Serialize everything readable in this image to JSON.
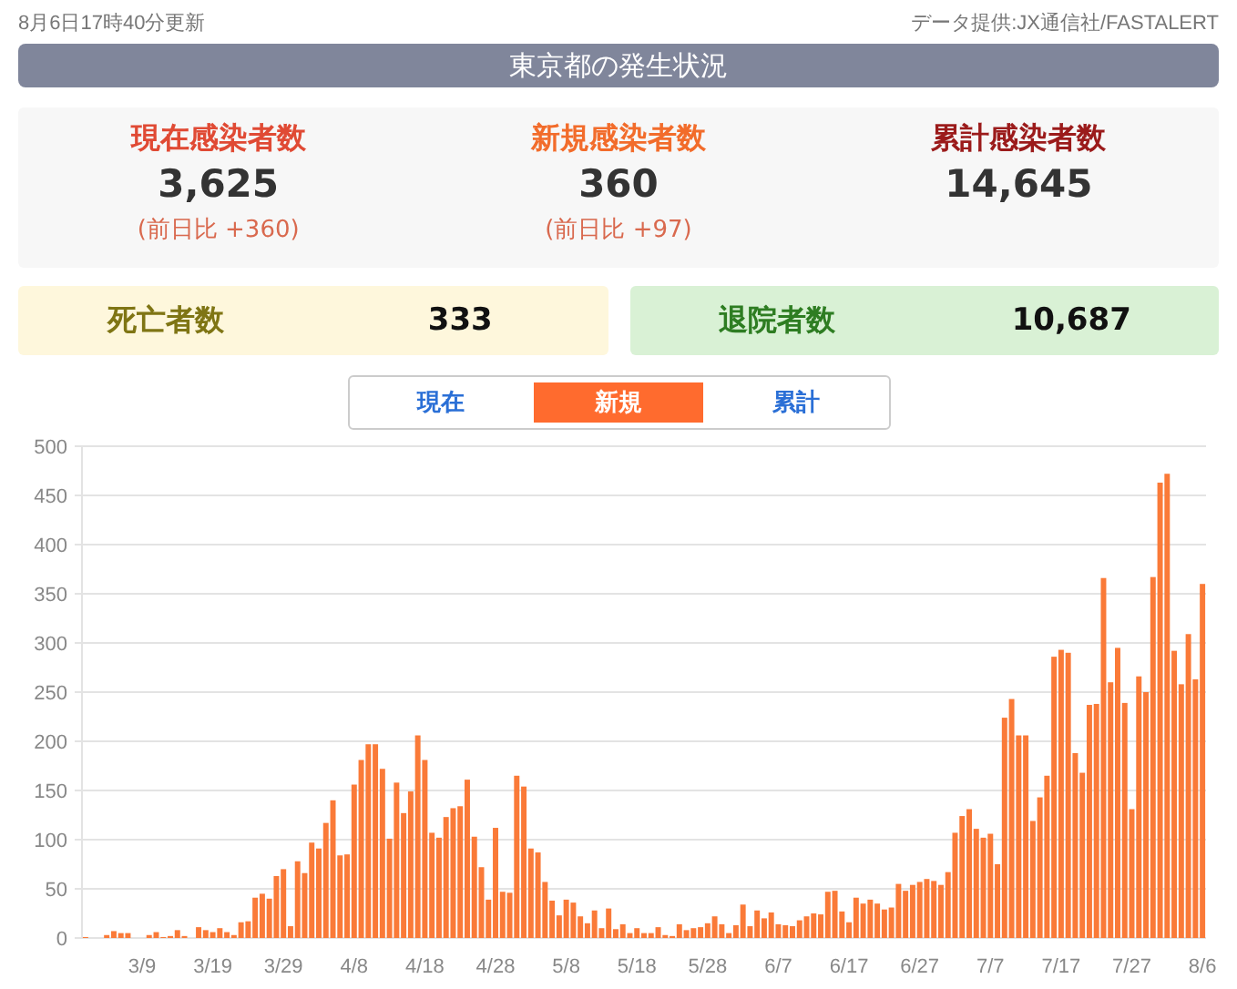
{
  "updated": "8月6日17時40分更新",
  "source": "データ提供:JX通信社/FASTALERT",
  "title": "東京都の発生状況",
  "stats": [
    {
      "kind": "current",
      "label": "現在感染者数",
      "value": "3,625",
      "change": "(前日比 +360)"
    },
    {
      "kind": "new",
      "label": "新規感染者数",
      "value": "360",
      "change": "(前日比 +97)"
    },
    {
      "kind": "total",
      "label": "累計感染者数",
      "value": "14,645"
    }
  ],
  "outcomes": [
    {
      "kind": "deaths",
      "label": "死亡者数",
      "value": "333"
    },
    {
      "kind": "discharged",
      "label": "退院者数",
      "value": "10,687"
    }
  ],
  "tabs": [
    {
      "label": "現在",
      "selected": false
    },
    {
      "label": "新規",
      "selected": true
    },
    {
      "label": "累計",
      "selected": false
    }
  ],
  "chart": {
    "chart_data": {
      "type": "bar",
      "grid": true,
      "categories": [
        null,
        null,
        null,
        null,
        null,
        null,
        null,
        null,
        "3/9",
        null,
        null,
        null,
        null,
        null,
        null,
        null,
        null,
        null,
        "3/19",
        null,
        null,
        null,
        null,
        null,
        null,
        null,
        null,
        null,
        "3/29",
        null,
        null,
        null,
        null,
        null,
        null,
        null,
        null,
        null,
        "4/8",
        null,
        null,
        null,
        null,
        null,
        null,
        null,
        null,
        null,
        "4/18",
        null,
        null,
        null,
        null,
        null,
        null,
        null,
        null,
        null,
        "4/28",
        null,
        null,
        null,
        null,
        null,
        null,
        null,
        null,
        null,
        "5/8",
        null,
        null,
        null,
        null,
        null,
        null,
        null,
        null,
        null,
        "5/18",
        null,
        null,
        null,
        null,
        null,
        null,
        null,
        null,
        null,
        "5/28",
        null,
        null,
        null,
        null,
        null,
        null,
        null,
        null,
        null,
        "6/7",
        null,
        null,
        null,
        null,
        null,
        null,
        null,
        null,
        null,
        "6/17",
        null,
        null,
        null,
        null,
        null,
        null,
        null,
        null,
        null,
        "6/27",
        null,
        null,
        null,
        null,
        null,
        null,
        null,
        null,
        null,
        "7/7",
        null,
        null,
        null,
        null,
        null,
        null,
        null,
        null,
        null,
        "7/17",
        null,
        null,
        null,
        null,
        null,
        null,
        null,
        null,
        null,
        "7/27",
        null,
        null,
        null,
        null,
        null,
        null,
        null,
        null,
        null,
        "8/6"
      ],
      "series": [
        {
          "color": "#fa7a38",
          "values": [
            1,
            0,
            0,
            3,
            7,
            5,
            5,
            0,
            0,
            3,
            6,
            1,
            2,
            8,
            2,
            0,
            11,
            8,
            6,
            10,
            6,
            3,
            16,
            17,
            41,
            45,
            40,
            63,
            70,
            12,
            78,
            66,
            97,
            91,
            117,
            140,
            84,
            85,
            156,
            181,
            197,
            197,
            172,
            101,
            158,
            127,
            149,
            206,
            181,
            107,
            102,
            123,
            132,
            134,
            161,
            103,
            72,
            39,
            112,
            47,
            46,
            165,
            154,
            91,
            87,
            57,
            38,
            23,
            39,
            36,
            22,
            15,
            28,
            10,
            30,
            9,
            14,
            5,
            10,
            5,
            5,
            11,
            3,
            2,
            14,
            8,
            10,
            11,
            15,
            22,
            14,
            5,
            13,
            34,
            12,
            28,
            20,
            26,
            14,
            13,
            12,
            18,
            22,
            25,
            24,
            47,
            48,
            27,
            16,
            41,
            35,
            39,
            35,
            29,
            31,
            55,
            48,
            54,
            57,
            60,
            58,
            54,
            67,
            107,
            124,
            131,
            111,
            102,
            106,
            75,
            224,
            243,
            206,
            206,
            119,
            143,
            165,
            286,
            293,
            290,
            188,
            168,
            237,
            238,
            366,
            260,
            295,
            239,
            131,
            266,
            250,
            367,
            463,
            472,
            292,
            258,
            309,
            263,
            360
          ]
        }
      ],
      "ylim": [
        0,
        500
      ],
      "yticks": [
        0,
        50,
        100,
        150,
        200,
        250,
        300,
        350,
        400,
        450,
        500
      ]
    }
  }
}
